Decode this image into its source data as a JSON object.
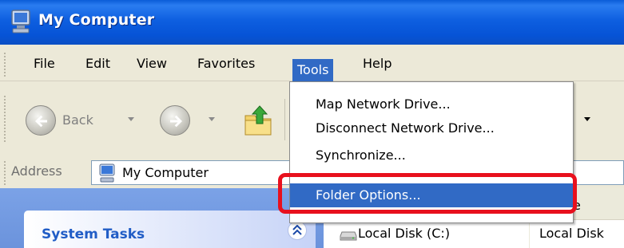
{
  "window": {
    "title": "My Computer"
  },
  "menubar": {
    "items": [
      {
        "label": "File"
      },
      {
        "label": "Edit"
      },
      {
        "label": "View"
      },
      {
        "label": "Favorites"
      },
      {
        "label": "Tools"
      },
      {
        "label": "Help"
      }
    ],
    "active": "Tools"
  },
  "toolbar": {
    "back_label": "Back",
    "icons": [
      "back-arrow-icon",
      "forward-arrow-icon",
      "up-folder-icon"
    ]
  },
  "address": {
    "label": "Address",
    "value": "My Computer"
  },
  "tools_menu": {
    "items": [
      {
        "label": "Map Network Drive..."
      },
      {
        "label": "Disconnect Network Drive..."
      },
      {
        "label": "Synchronize..."
      },
      {
        "label": "Folder Options..."
      }
    ],
    "highlighted": "Folder Options..."
  },
  "tasks": {
    "system_tasks_title": "System Tasks"
  },
  "file_list": {
    "column_partial": "e",
    "rows": [
      {
        "name": "Local Disk (C:)",
        "type": "Local Disk"
      }
    ]
  },
  "colors": {
    "title_bar": "#0a5cd8",
    "menu_highlight": "#316ac5",
    "callout": "#e8101d",
    "task_title": "#215dc6"
  }
}
